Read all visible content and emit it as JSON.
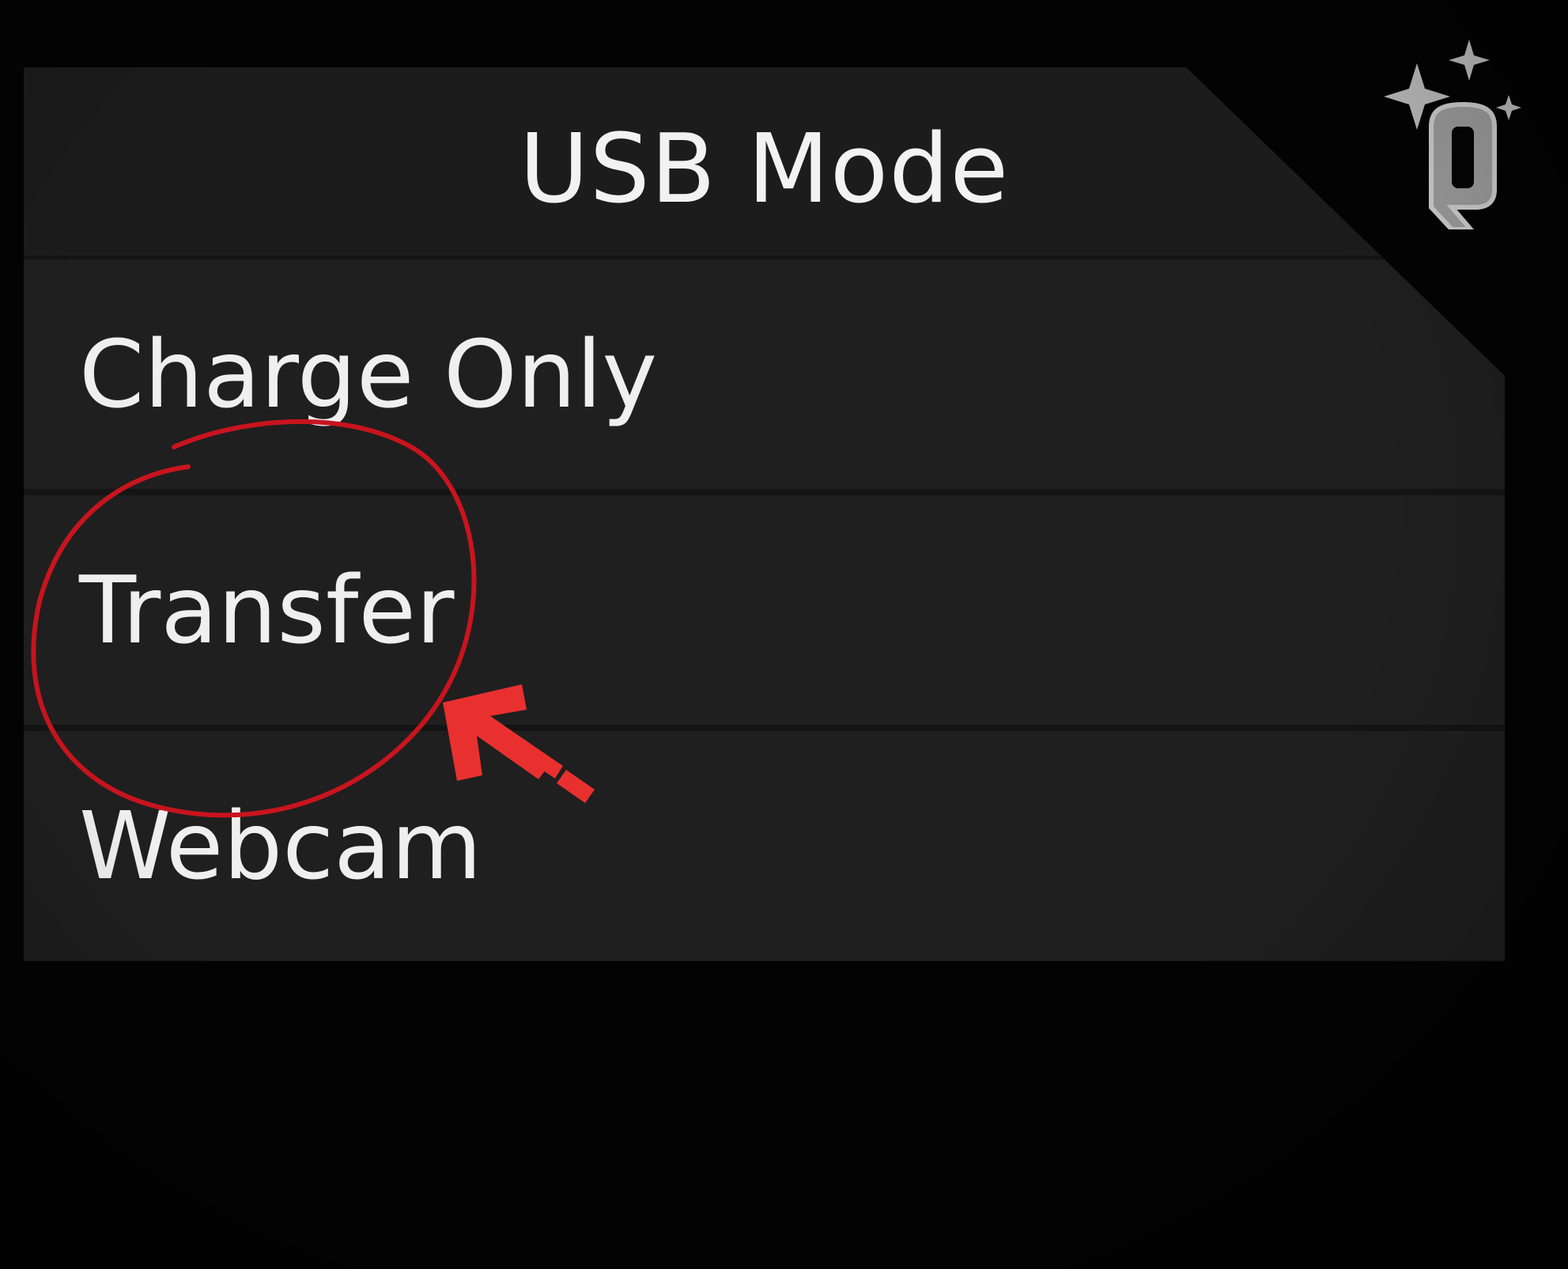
{
  "screen": {
    "title": "USB Mode",
    "options": [
      {
        "label": "Charge Only"
      },
      {
        "label": "Transfer"
      },
      {
        "label": "Webcam"
      }
    ]
  },
  "annotation": {
    "highlight_color": "#c8141e",
    "arrow_color": "#e8302f",
    "highlighted_option": "Transfer"
  },
  "logo": {
    "icon": "q-sparkle-logo-icon"
  }
}
